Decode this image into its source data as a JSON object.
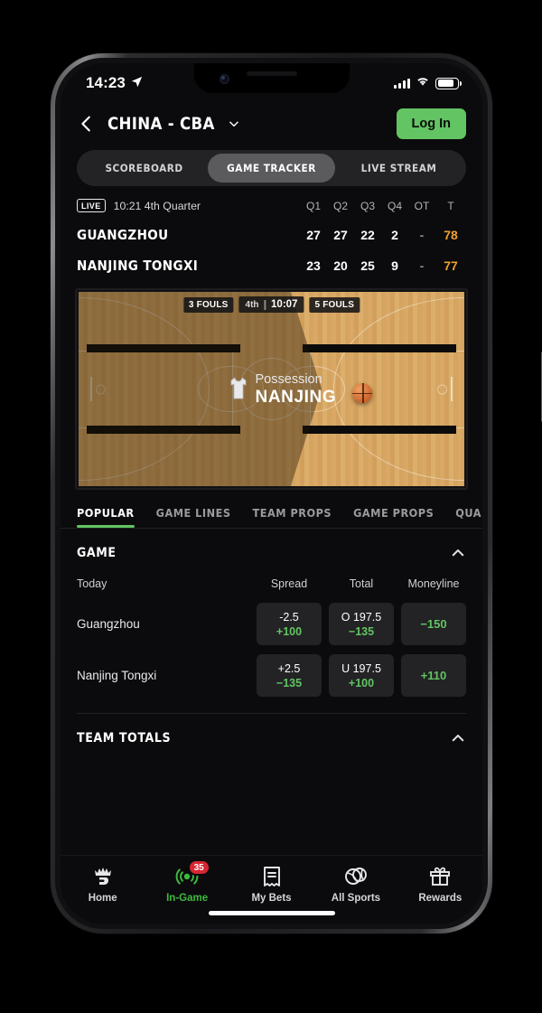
{
  "status_bar": {
    "time": "14:23",
    "location_icon": "location-arrow-icon",
    "signal_icon": "cellular-bars-icon",
    "wifi_icon": "wifi-icon",
    "battery_icon": "battery-icon"
  },
  "header": {
    "back_icon": "chevron-left-icon",
    "title": "CHINA - CBA",
    "dropdown_icon": "chevron-down-icon",
    "login_label": "Log In",
    "accent_green": "#62c462"
  },
  "segmented": {
    "items": [
      {
        "label": "SCOREBOARD",
        "active": false
      },
      {
        "label": "GAME TRACKER",
        "active": true
      },
      {
        "label": "LIVE STREAM",
        "active": false
      }
    ]
  },
  "scoreboard": {
    "live_label": "LIVE",
    "period_text": "10:21 4th Quarter",
    "columns": [
      "Q1",
      "Q2",
      "Q3",
      "Q4",
      "OT",
      "T"
    ],
    "total_color": "#f0a030",
    "rows": [
      {
        "team": "GUANGZHOU",
        "quarters": [
          "27",
          "27",
          "22",
          "2",
          "-"
        ],
        "total": "78"
      },
      {
        "team": "NANJING TONGXI",
        "quarters": [
          "23",
          "20",
          "25",
          "9",
          "-"
        ],
        "total": "77"
      }
    ]
  },
  "court": {
    "home_fouls": "3 FOULS",
    "away_fouls": "5 FOULS",
    "period": "4th",
    "clock": "10:07",
    "possession_label": "Possession",
    "possession_team": "NANJING",
    "jersey_icon": "jersey-icon",
    "ball_icon": "basketball-icon"
  },
  "market_tabs": [
    {
      "label": "POPULAR",
      "active": true
    },
    {
      "label": "GAME LINES",
      "active": false
    },
    {
      "label": "TEAM PROPS",
      "active": false
    },
    {
      "label": "GAME PROPS",
      "active": false
    },
    {
      "label": "QUARTE",
      "active": false
    }
  ],
  "game_section": {
    "title": "GAME",
    "collapse_icon": "chevron-up-icon",
    "date_label": "Today",
    "columns": [
      "Spread",
      "Total",
      "Moneyline"
    ],
    "rows": [
      {
        "team": "Guangzhou",
        "spread_line": "-2.5",
        "spread_price": "+100",
        "total_line": "O 197.5",
        "total_price": "−135",
        "moneyline": "−150"
      },
      {
        "team": "Nanjing Tongxi",
        "spread_line": "+2.5",
        "spread_price": "−135",
        "total_line": "U 197.5",
        "total_price": "+100",
        "moneyline": "+110"
      }
    ]
  },
  "team_totals_section": {
    "title": "TEAM TOTALS",
    "collapse_icon": "chevron-up-icon"
  },
  "bottom_nav": [
    {
      "label": "Home",
      "icon": "crown-icon",
      "active": false,
      "badge": null
    },
    {
      "label": "In-Game",
      "icon": "live-signal-icon",
      "active": true,
      "badge": "35"
    },
    {
      "label": "My Bets",
      "icon": "receipt-icon",
      "active": false,
      "badge": null
    },
    {
      "label": "All Sports",
      "icon": "all-sports-icon",
      "active": false,
      "badge": null
    },
    {
      "label": "Rewards",
      "icon": "gift-icon",
      "active": false,
      "badge": null
    }
  ]
}
